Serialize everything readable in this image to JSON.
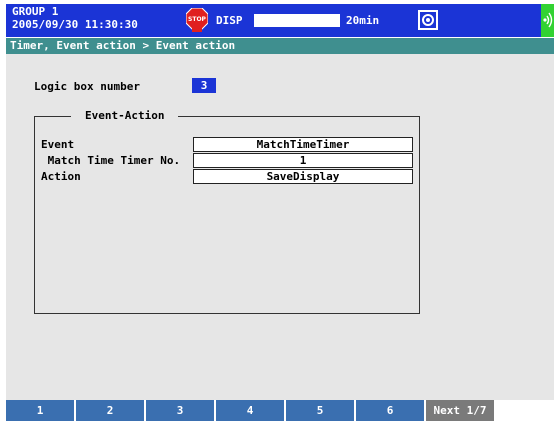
{
  "status_bar": {
    "group_name": "GROUP 1",
    "datetime": "2005/09/30 11:30:30",
    "stop_icon": "stop-icon",
    "display_label": "DISP",
    "interval": "20min",
    "camera_icon": "camera-icon",
    "comm_icon": "communication-icon",
    "colors": {
      "bar": "#1b34d6",
      "comm": "#32d232"
    }
  },
  "breadcrumb": "Timer, Event action > Event action",
  "main": {
    "logic_box_label": "Logic box number",
    "logic_box_value": "3",
    "group_title": "Event-Action",
    "rows": [
      {
        "label": "Event",
        "value": "MatchTimeTimer"
      },
      {
        "label": " Match Time Timer No.",
        "value": "1"
      },
      {
        "label": "Action",
        "value": "SaveDisplay"
      }
    ]
  },
  "softkeys": [
    "1",
    "2",
    "3",
    "4",
    "5",
    "6",
    "Next 1/7"
  ]
}
